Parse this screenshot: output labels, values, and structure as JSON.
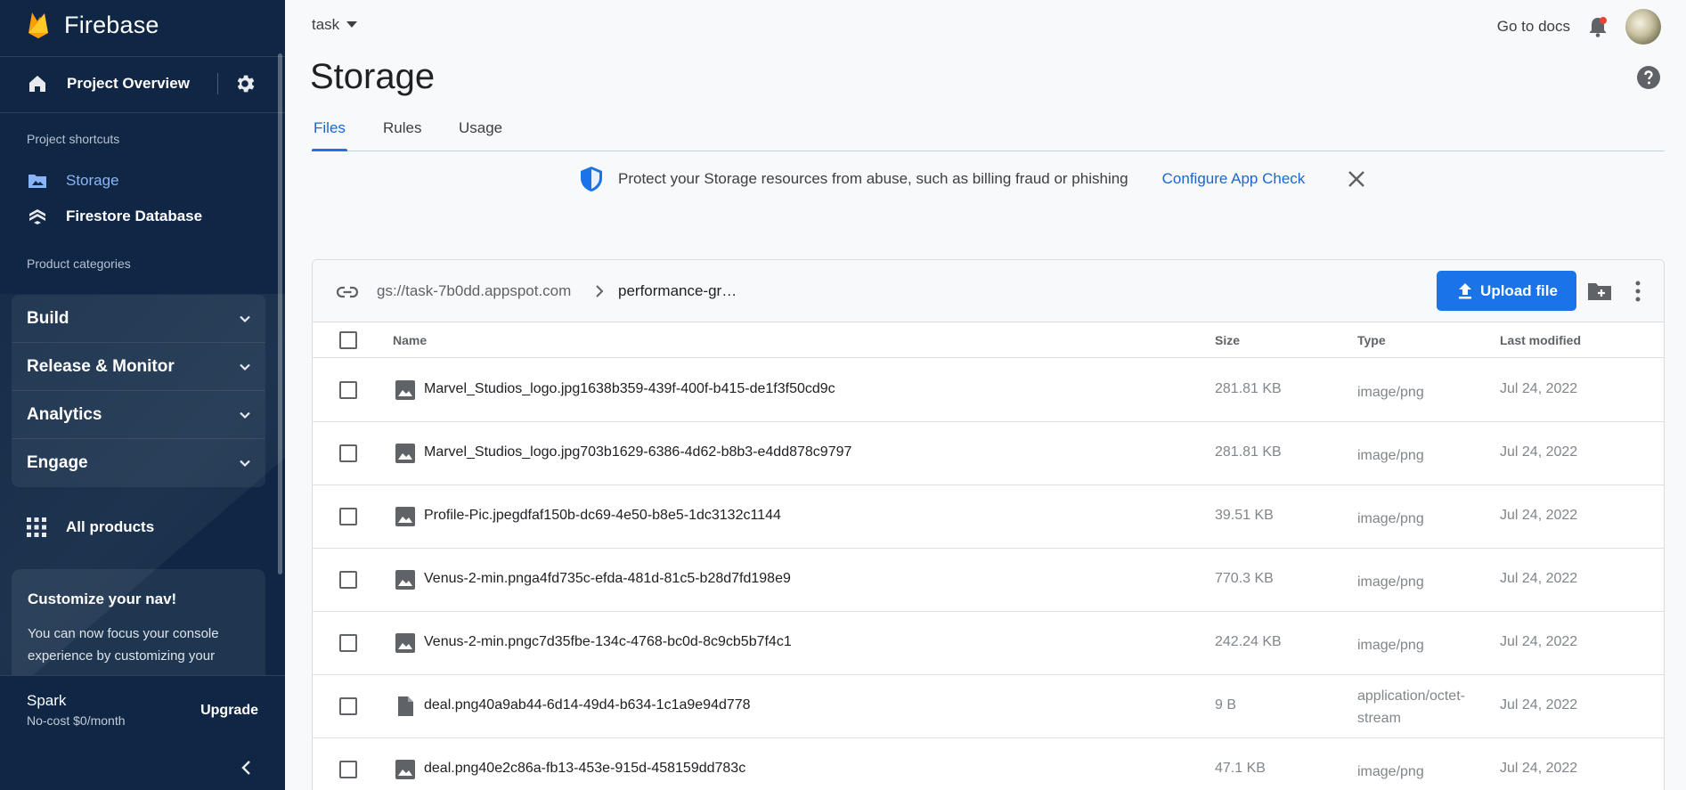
{
  "sidebar": {
    "brand": "Firebase",
    "project_overview": "Project Overview",
    "shortcuts_heading": "Project shortcuts",
    "shortcuts": [
      {
        "label": "Storage",
        "icon": "folder-image-icon",
        "active": true
      },
      {
        "label": "Firestore Database",
        "icon": "firestore-icon",
        "active": false
      }
    ],
    "categories_heading": "Product categories",
    "categories": [
      "Build",
      "Release & Monitor",
      "Analytics",
      "Engage"
    ],
    "all_products": "All products",
    "customize": {
      "title": "Customize your nav!",
      "body": "You can now focus your console experience by customizing your"
    },
    "plan": {
      "name": "Spark",
      "subtitle": "No-cost $0/month",
      "upgrade": "Upgrade"
    }
  },
  "header": {
    "project": "task",
    "go_to_docs": "Go to docs"
  },
  "page": {
    "title": "Storage",
    "tabs": [
      {
        "label": "Files",
        "active": true
      },
      {
        "label": "Rules",
        "active": false
      },
      {
        "label": "Usage",
        "active": false
      }
    ]
  },
  "banner": {
    "message": "Protect your Storage resources from abuse, such as billing fraud or phishing",
    "action": "Configure App Check"
  },
  "browser": {
    "bucket": "gs://task-7b0dd.appspot.com",
    "current_folder": "performance-gr…",
    "upload_label": "Upload file",
    "columns": {
      "name": "Name",
      "size": "Size",
      "type": "Type",
      "modified": "Last modified"
    },
    "files": [
      {
        "name": "Marvel_Studios_logo.jpg1638b359-439f-400f-b415-de1f3f50cd9c",
        "size": "281.81 KB",
        "type": "image/png",
        "modified": "Jul 24, 2022",
        "icon": "image-file-icon"
      },
      {
        "name": "Marvel_Studios_logo.jpg703b1629-6386-4d62-b8b3-e4dd878c9797",
        "size": "281.81 KB",
        "type": "image/png",
        "modified": "Jul 24, 2022",
        "icon": "image-file-icon"
      },
      {
        "name": "Profile-Pic.jpegdfaf150b-dc69-4e50-b8e5-1dc3132c1144",
        "size": "39.51 KB",
        "type": "image/png",
        "modified": "Jul 24, 2022",
        "icon": "image-file-icon"
      },
      {
        "name": "Venus-2-min.pnga4fd735c-efda-481d-81c5-b28d7fd198e9",
        "size": "770.3 KB",
        "type": "image/png",
        "modified": "Jul 24, 2022",
        "icon": "image-file-icon"
      },
      {
        "name": "Venus-2-min.pngc7d35fbe-134c-4768-bc0d-8c9cb5b7f4c1",
        "size": "242.24 KB",
        "type": "image/png",
        "modified": "Jul 24, 2022",
        "icon": "image-file-icon"
      },
      {
        "name": "deal.png40a9ab44-6d14-49d4-b634-1c1a9e94d778",
        "size": "9 B",
        "type": "application/octet-stream",
        "modified": "Jul 24, 2022",
        "icon": "generic-file-icon"
      },
      {
        "name": "deal.png40e2c86a-fb13-453e-915d-458159dd783c",
        "size": "47.1 KB",
        "type": "image/png",
        "modified": "Jul 24, 2022",
        "icon": "image-file-icon"
      }
    ]
  },
  "colors": {
    "sidebar_bg": "#0f2744",
    "accent": "#1a73e8",
    "active_link": "#8ab4f8",
    "notification_dot": "#ea4335"
  }
}
